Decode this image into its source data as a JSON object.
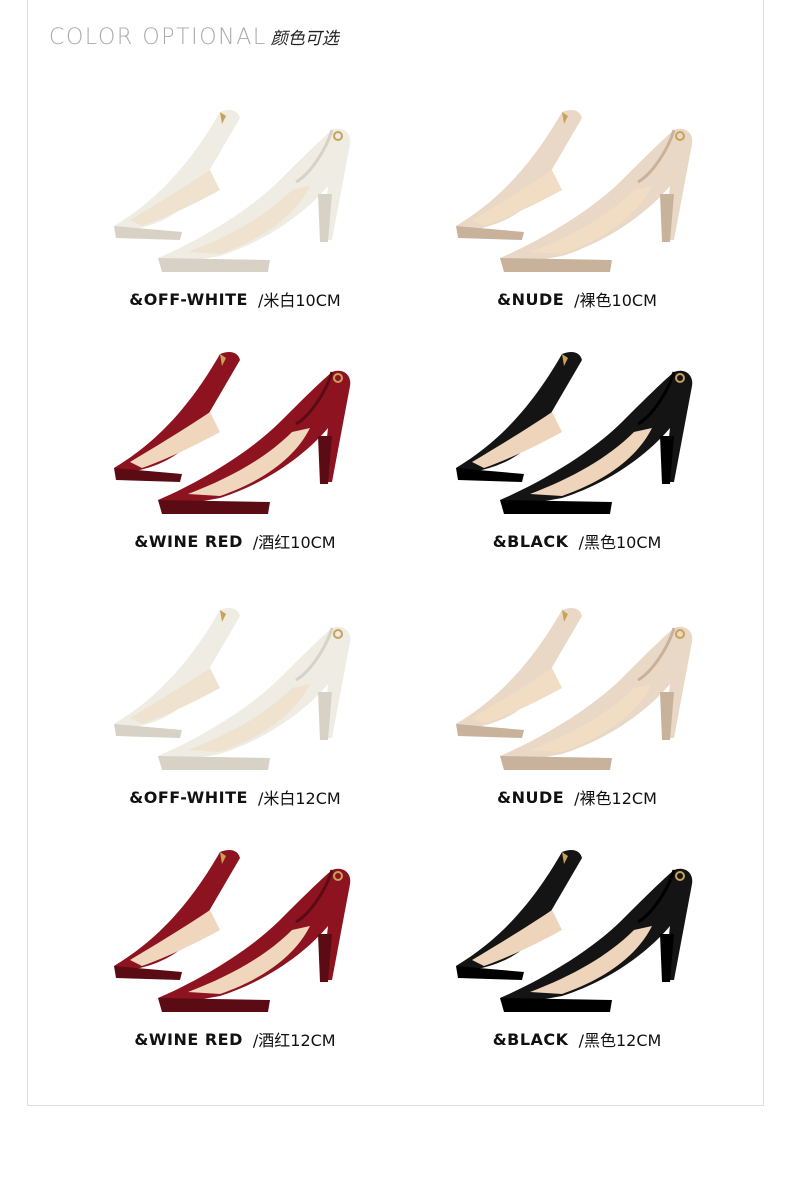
{
  "header": {
    "title_en": "COLOR OPTIONAL",
    "title_cn": "颜色可选"
  },
  "products": [
    {
      "name": "&OFF-WHITE",
      "desc": "/米白10CM",
      "color": "#efece4",
      "shade": "#d8d2c6",
      "lining": "#efe2cf"
    },
    {
      "name": "&NUDE",
      "desc": "/裸色10CM",
      "color": "#ead8c6",
      "shade": "#c9b29c",
      "lining": "#f1dcc4"
    },
    {
      "name": "&WINE RED",
      "desc": "/酒红10CM",
      "color": "#8e1320",
      "shade": "#5a0b14",
      "lining": "#efd6bc"
    },
    {
      "name": "&BLACK",
      "desc": "/黑色10CM",
      "color": "#141414",
      "shade": "#000000",
      "lining": "#eed4bb"
    },
    {
      "name": "&OFF-WHITE",
      "desc": "/米白12CM",
      "color": "#efece4",
      "shade": "#d8d2c6",
      "lining": "#efe2cf"
    },
    {
      "name": "&NUDE",
      "desc": "/裸色12CM",
      "color": "#ead8c6",
      "shade": "#c9b29c",
      "lining": "#f1dcc4"
    },
    {
      "name": "&WINE RED",
      "desc": "/酒红12CM",
      "color": "#8e1320",
      "shade": "#5a0b14",
      "lining": "#efd6bc"
    },
    {
      "name": "&BLACK",
      "desc": "/黑色12CM",
      "color": "#141414",
      "shade": "#000000",
      "lining": "#eed4bb"
    }
  ]
}
